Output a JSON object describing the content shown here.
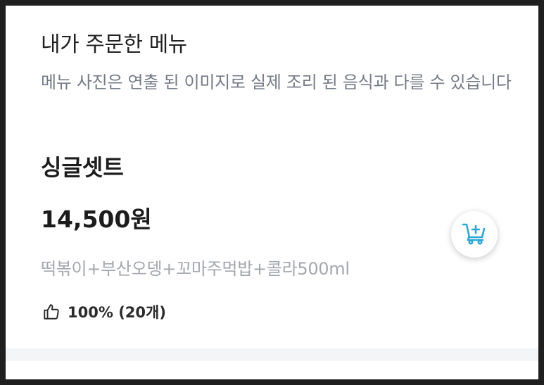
{
  "order_section": {
    "title": "내가 주문한 메뉴",
    "notice": "메뉴 사진은 연출 된 이미지로 실제 조리 된 음식과 다를 수 있습니다"
  },
  "menu_item": {
    "name": "싱글셋트",
    "price": "14,500원",
    "description": "떡볶이+부산오뎅+꼬마주먹밥+콜라500ml",
    "rating": "100% (20개)",
    "rating_icon": "thumbs-up-icon",
    "cart_icon": "add-to-cart-icon"
  },
  "colors": {
    "accent": "#2ba8d8",
    "muted_text": "#757b85",
    "light_text": "#a3a7ad"
  }
}
